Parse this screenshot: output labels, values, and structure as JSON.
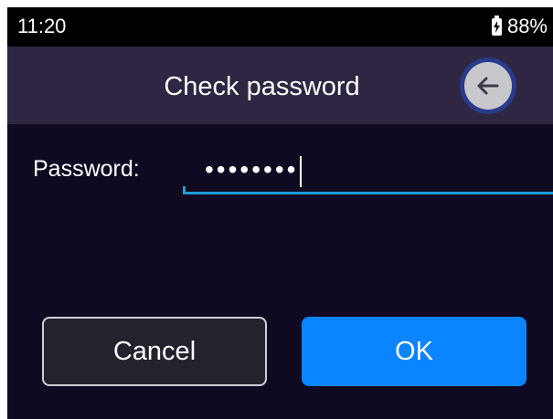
{
  "status_bar": {
    "time": "11:20",
    "battery_icon": "battery-charging-icon",
    "battery_percent": "88%"
  },
  "header": {
    "title": "Check password",
    "back_icon": "back-arrow-icon"
  },
  "form": {
    "password_label": "Password:",
    "password_value": "••••••••"
  },
  "buttons": {
    "cancel_label": "Cancel",
    "ok_label": "OK"
  },
  "colors": {
    "background": "#0f0a22",
    "title_bar": "#2e2642",
    "accent": "#0a84ff",
    "input_underline": "#1e9bd8"
  }
}
